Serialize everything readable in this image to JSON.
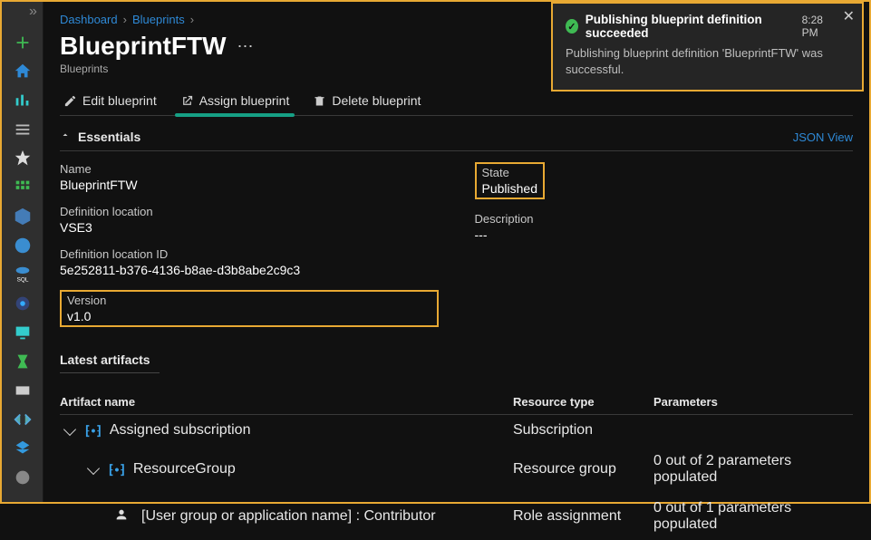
{
  "breadcrumbs": {
    "item1": "Dashboard",
    "item2": "Blueprints"
  },
  "title": "BlueprintFTW",
  "subtitle": "Blueprints",
  "toolbar": {
    "edit": "Edit blueprint",
    "assign": "Assign blueprint",
    "delete": "Delete blueprint"
  },
  "essentials": {
    "header": "Essentials",
    "jsonView": "JSON View"
  },
  "props": {
    "nameLabel": "Name",
    "nameValue": "BlueprintFTW",
    "defLocLabel": "Definition location",
    "defLocValue": "VSE3",
    "defLocIdLabel": "Definition location ID",
    "defLocIdValue": "5e252811-b376-4136-b8ae-d3b8abe2c9c3",
    "versionLabel": "Version",
    "versionValue": "v1.0",
    "stateLabel": "State",
    "stateValue": "Published",
    "descLabel": "Description",
    "descValue": "---"
  },
  "artifactsHeader": "Latest artifacts",
  "tableHeaders": {
    "artifact": "Artifact name",
    "resType": "Resource type",
    "params": "Parameters"
  },
  "rows": [
    {
      "name": "Assigned subscription",
      "type": "Subscription",
      "params": ""
    },
    {
      "name": "ResourceGroup",
      "type": "Resource group",
      "params": "0 out of 2 parameters populated"
    },
    {
      "name": "[User group or application name] : Contributor",
      "type": "Role assignment",
      "params": "0 out of 1 parameters populated"
    }
  ],
  "notif": {
    "title": "Publishing blueprint definition succeeded",
    "time": "8:28 PM",
    "body": "Publishing blueprint definition 'BlueprintFTW' was successful."
  }
}
